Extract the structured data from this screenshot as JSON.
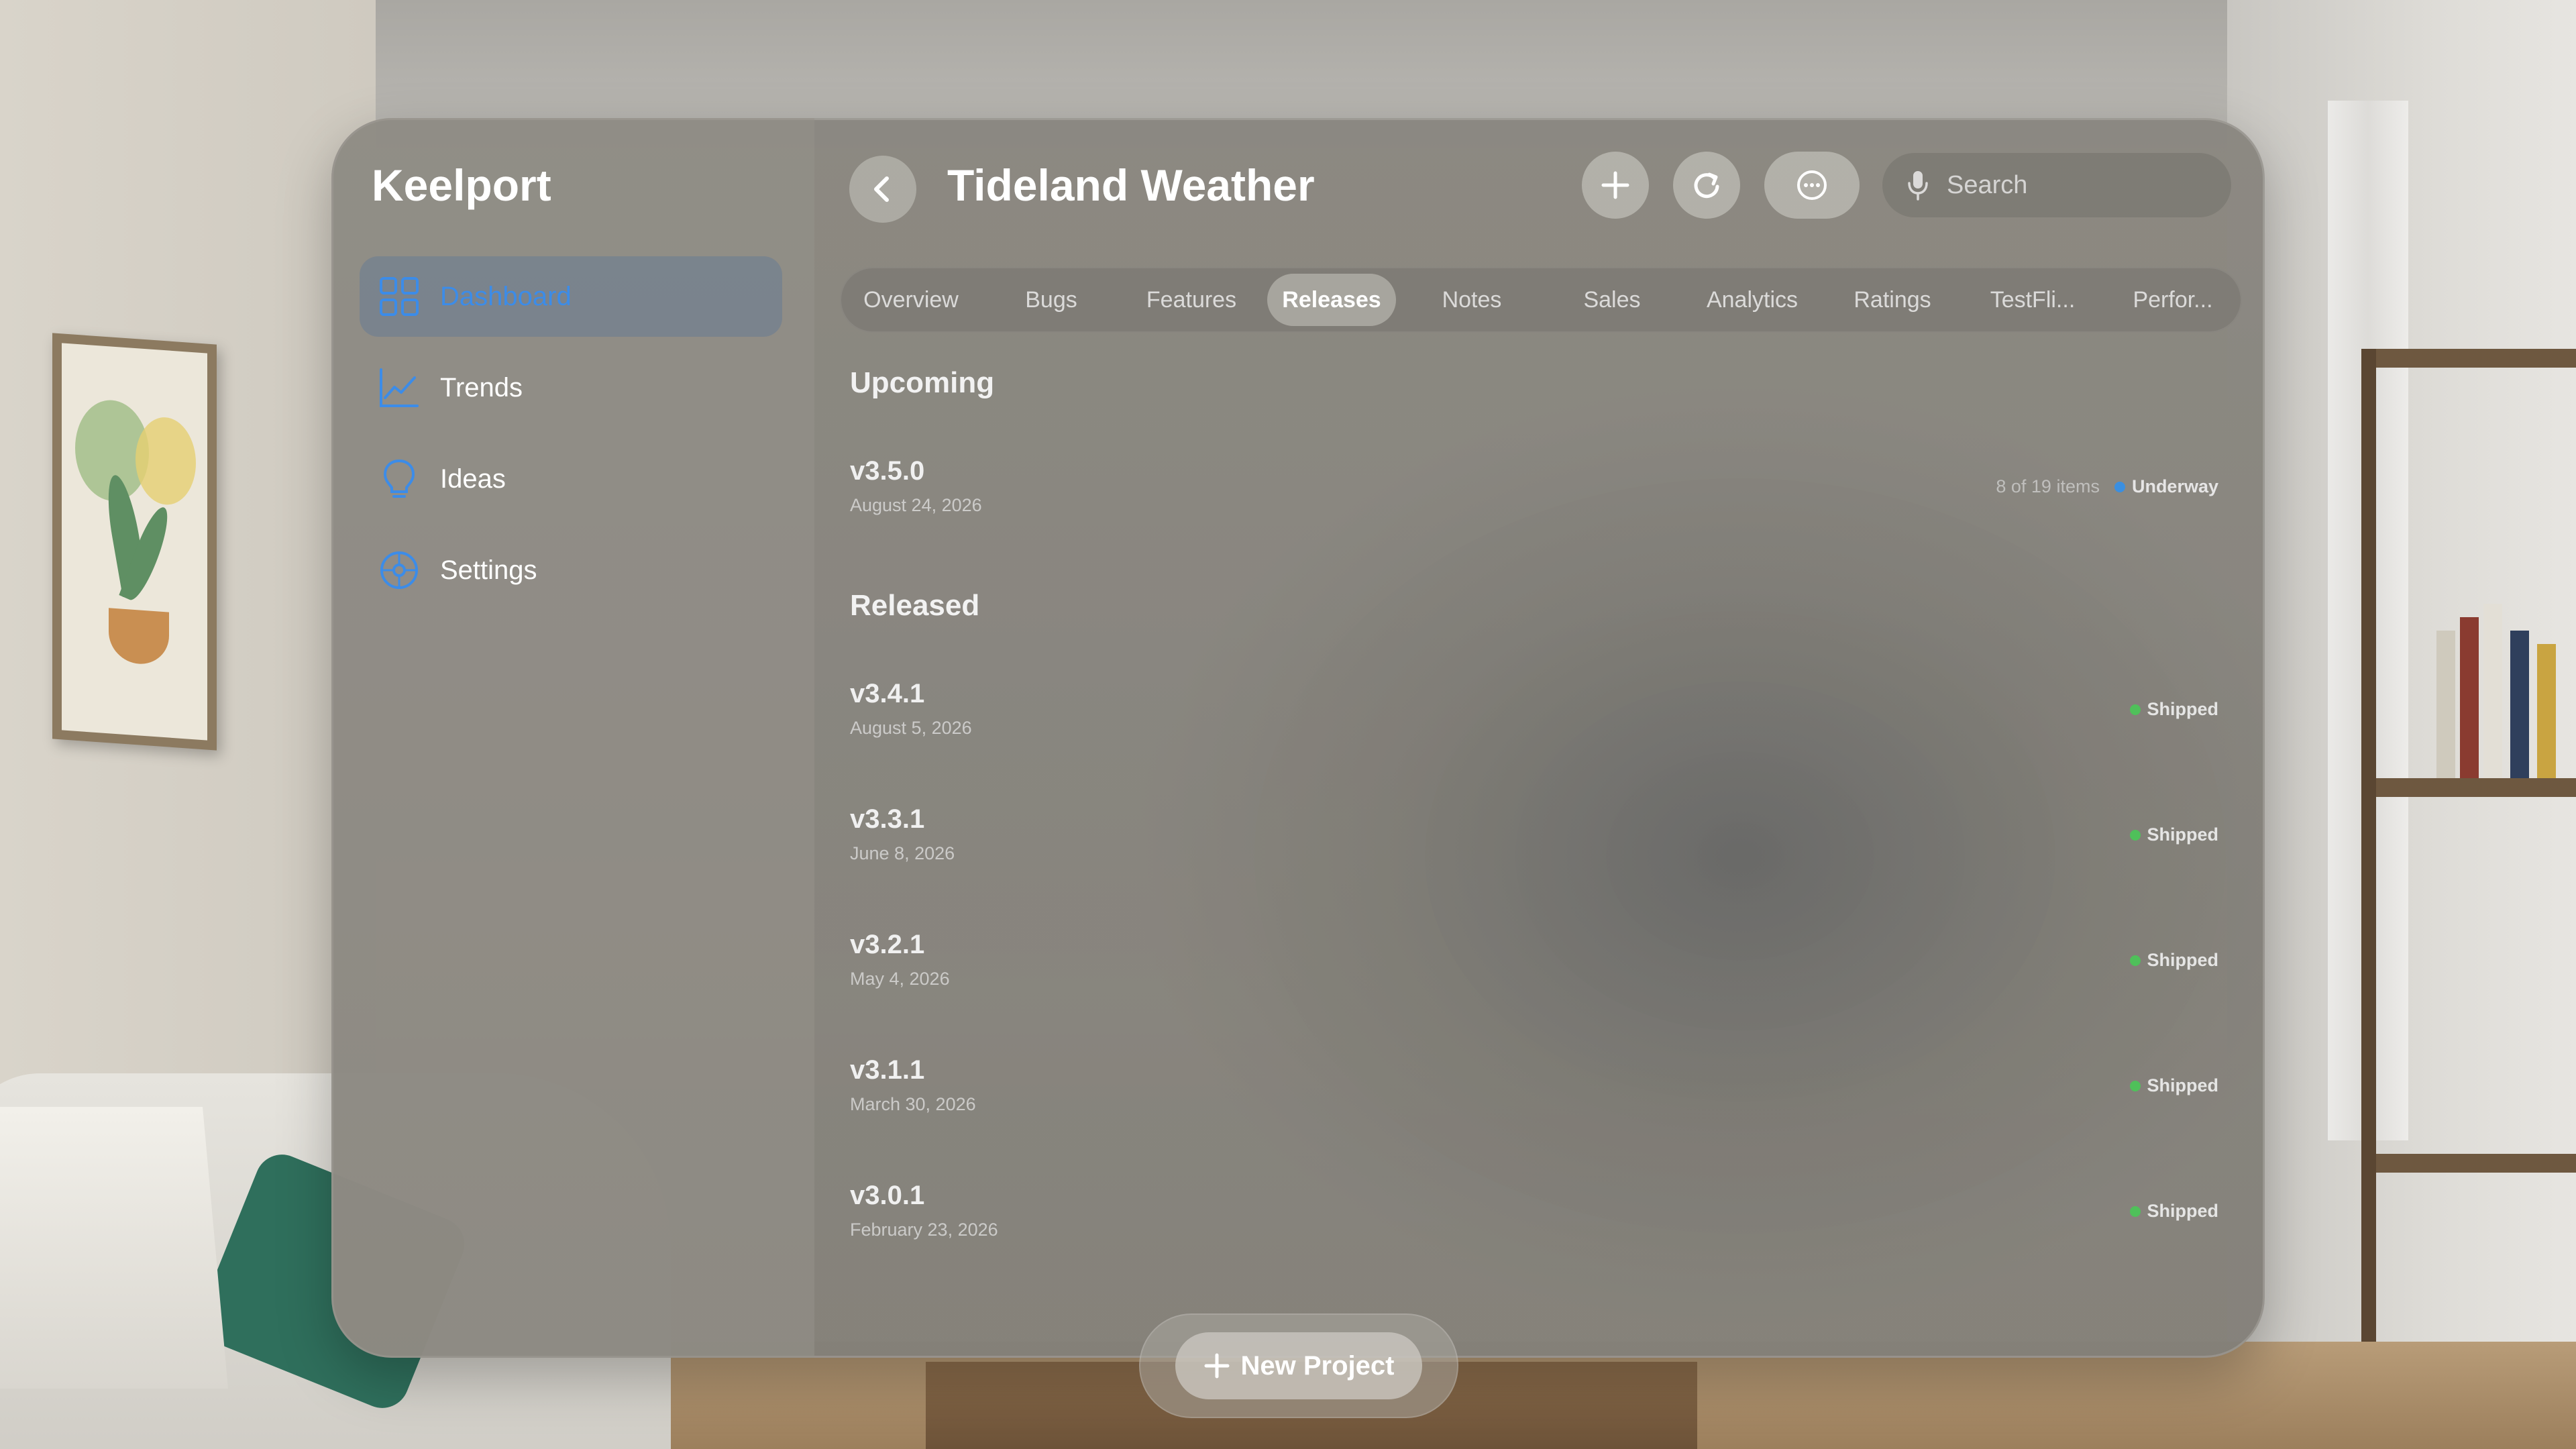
{
  "sidebar": {
    "app_title": "Keelport",
    "items": [
      {
        "label": "Dashboard",
        "icon": "grid-icon",
        "active": true
      },
      {
        "label": "Trends",
        "icon": "chart-line-icon",
        "active": false
      },
      {
        "label": "Ideas",
        "icon": "lightbulb-icon",
        "active": false
      },
      {
        "label": "Settings",
        "icon": "gear-icon",
        "active": false
      }
    ]
  },
  "header": {
    "title": "Tideland Weather",
    "search_placeholder": "Search"
  },
  "tabs": [
    {
      "label": "Overview"
    },
    {
      "label": "Bugs"
    },
    {
      "label": "Features"
    },
    {
      "label": "Releases",
      "active": true
    },
    {
      "label": "Notes"
    },
    {
      "label": "Sales"
    },
    {
      "label": "Analytics"
    },
    {
      "label": "Ratings"
    },
    {
      "label": "TestFli..."
    },
    {
      "label": "Perfor..."
    }
  ],
  "sections": {
    "upcoming": "Upcoming",
    "released": "Released"
  },
  "upcoming": [
    {
      "version": "v3.5.0",
      "date": "August 24, 2026",
      "progress": "8 of 19 items",
      "status": "Underway"
    }
  ],
  "released": [
    {
      "version": "v3.4.1",
      "date": "August 5, 2026",
      "status": "Shipped"
    },
    {
      "version": "v3.3.1",
      "date": "June 8, 2026",
      "status": "Shipped"
    },
    {
      "version": "v3.2.1",
      "date": "May 4, 2026",
      "status": "Shipped"
    },
    {
      "version": "v3.1.1",
      "date": "March 30, 2026",
      "status": "Shipped"
    },
    {
      "version": "v3.0.1",
      "date": "February 23, 2026",
      "status": "Shipped"
    }
  ],
  "bottom": {
    "new_project_label": "New Project"
  },
  "colors": {
    "accent": "#3c8ce8",
    "underway": "#3b8fe0",
    "shipped": "#4fc05a"
  }
}
